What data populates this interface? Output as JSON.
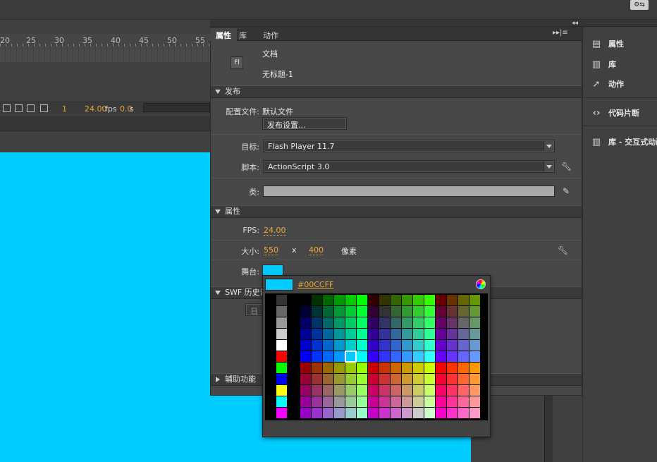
{
  "toolbar": {
    "gear_icon": "gear-icon"
  },
  "timeline": {
    "ticks": [
      "20",
      "25",
      "30",
      "35",
      "40",
      "45",
      "50",
      "55"
    ],
    "frame": "1",
    "fps": "24.00",
    "fps_unit": "fps",
    "time": "0.0",
    "time_unit": "s"
  },
  "stage": {
    "color": "#00ccff"
  },
  "props_panel": {
    "tabs": [
      "属性",
      "库",
      "动作"
    ],
    "doc_icon": "Fl",
    "doc_type": "文档",
    "doc_name": "无标题-1",
    "publish": {
      "header": "发布",
      "profile_label": "配置文件:",
      "profile_value": "默认文件",
      "settings_button": "发布设置...",
      "target_label": "目标:",
      "target_value": "Flash Player 11.7",
      "script_label": "脚本:",
      "script_value": "ActionScript 3.0",
      "class_label": "类:",
      "class_value": ""
    },
    "properties": {
      "header": "属性",
      "fps_label": "FPS:",
      "fps_value": "24.00",
      "size_label": "大小:",
      "width": "550",
      "x": "x",
      "height": "400",
      "unit": "像素",
      "stage_label": "舞台:",
      "stage_color": "#00ccff"
    },
    "swf_history": {
      "header": "SWF 历史记",
      "partial": "日"
    },
    "accessibility": {
      "header": "辅助功能"
    }
  },
  "color_picker": {
    "hex": "#00CCFF",
    "selected": "#00ccff"
  },
  "right_panel": {
    "items": [
      {
        "label": "属性",
        "icon": "properties-icon"
      },
      {
        "label": "库",
        "icon": "library-icon"
      },
      {
        "label": "动作",
        "icon": "actions-icon"
      },
      {
        "label": "代码片断",
        "icon": "code-snippets-icon"
      },
      {
        "label": "库 - 交互式动画",
        "icon": "library-icon"
      }
    ]
  }
}
